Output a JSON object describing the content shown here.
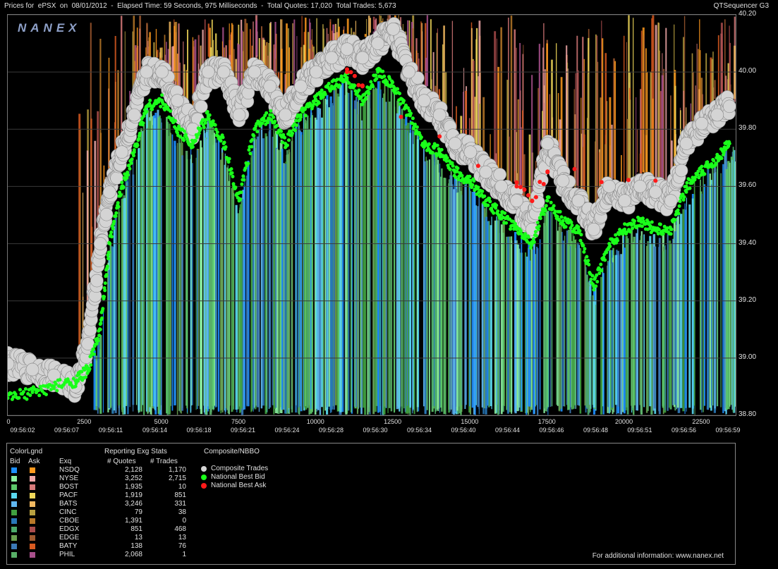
{
  "header": {
    "title": "Prices for  ePSX  on  08/01/2012  -  Elapsed Time: 59 Seconds, 975 Milliseconds  -  Total Quotes: 17,020  Total Trades: 5,673",
    "app": "QTSequencer G3"
  },
  "logo": "NANEX",
  "chart_data": {
    "type": "scatter",
    "ylim": [
      38.8,
      40.2
    ],
    "xlim": [
      0,
      23600
    ],
    "y_ticks": [
      "40.20",
      "40.00",
      "39.80",
      "39.60",
      "39.40",
      "39.20",
      "39.00",
      "38.80"
    ],
    "x_ticks": [
      "0",
      "2500",
      "5000",
      "7500",
      "10000",
      "12500",
      "15000",
      "17500",
      "20000",
      "22500"
    ],
    "time_labels": [
      "09:56:02",
      "09:56:07",
      "09:56:11",
      "09:56:14",
      "09:56:18",
      "09:56:21",
      "09:56:24",
      "09:56:28",
      "09:56:30",
      "09:56:34",
      "09:56:40",
      "09:56:44",
      "09:56:46",
      "09:56:48",
      "09:56:51",
      "09:56:56",
      "09:56:59"
    ],
    "series": [
      {
        "name": "Composite Trades",
        "x": [
          0,
          800,
          1500,
          2200,
          2600,
          3000,
          3300,
          3700,
          4100,
          4500,
          5000,
          5500,
          6000,
          6500,
          7000,
          7500,
          8000,
          8500,
          9000,
          9500,
          10000,
          10500,
          11000,
          11500,
          12000,
          12500,
          13000,
          13500,
          14000,
          14500,
          15000,
          15500,
          16000,
          16500,
          17000,
          17500,
          18000,
          18500,
          19000,
          19500,
          20000,
          20500,
          21000,
          21500,
          22000,
          22500,
          23000,
          23400
        ],
        "y": [
          38.98,
          38.96,
          38.94,
          38.9,
          39.05,
          39.4,
          39.58,
          39.72,
          39.85,
          40.0,
          40.0,
          39.9,
          39.8,
          40.0,
          40.0,
          39.85,
          40.0,
          39.95,
          39.85,
          39.95,
          40.0,
          40.05,
          40.08,
          40.05,
          40.1,
          40.15,
          40.0,
          39.9,
          39.85,
          39.75,
          39.72,
          39.65,
          39.6,
          39.55,
          39.45,
          39.75,
          39.62,
          39.55,
          39.45,
          39.6,
          39.55,
          39.6,
          39.58,
          39.55,
          39.75,
          39.82,
          39.85,
          39.88
        ]
      },
      {
        "name": "National Best Bid",
        "x": [
          0,
          800,
          1500,
          2200,
          2600,
          3000,
          3300,
          3700,
          4100,
          4500,
          5000,
          5500,
          6000,
          6500,
          7000,
          7500,
          8000,
          8500,
          9000,
          9500,
          10000,
          10500,
          11000,
          11500,
          12000,
          12500,
          13000,
          13500,
          14000,
          14500,
          15000,
          15500,
          16000,
          16500,
          17000,
          17500,
          18000,
          18500,
          19000,
          19500,
          20000,
          20500,
          21000,
          21500,
          22000,
          22500,
          23000,
          23400
        ],
        "y": [
          38.86,
          38.88,
          38.9,
          38.92,
          38.96,
          39.1,
          39.4,
          39.6,
          39.72,
          39.88,
          39.9,
          39.8,
          39.75,
          39.85,
          39.75,
          39.55,
          39.8,
          39.85,
          39.75,
          39.85,
          39.9,
          39.95,
          39.98,
          39.9,
          40.0,
          39.95,
          39.85,
          39.75,
          39.72,
          39.65,
          39.62,
          39.55,
          39.5,
          39.45,
          39.4,
          39.55,
          39.48,
          39.45,
          39.25,
          39.4,
          39.45,
          39.48,
          39.45,
          39.45,
          39.6,
          39.65,
          39.7,
          39.75
        ]
      },
      {
        "name": "National Best Ask",
        "x": [
          11000,
          11500,
          16500,
          17000,
          17500,
          21000
        ],
        "y": [
          40.0,
          39.95,
          39.6,
          39.55,
          39.65,
          39.62
        ]
      }
    ]
  },
  "legend": {
    "title": "ColorLgnd",
    "bid_hdr": "Bid",
    "ask_hdr": "Ask",
    "exq_hdr": "Exq",
    "stats_title": "Reporting Exg Stats",
    "quotes_hdr": "# Quotes",
    "trades_hdr": "# Trades",
    "composite_title": "Composite/NBBO",
    "rows": [
      {
        "exq": "NSDQ",
        "quotes": "2,128",
        "trades": "1,170",
        "bid": "#1e90ff",
        "ask": "#ff9a1e"
      },
      {
        "exq": "NYSE",
        "quotes": "3,252",
        "trades": "2,715",
        "bid": "#8cf0a0",
        "ask": "#f0a8a8"
      },
      {
        "exq": "BOST",
        "quotes": "1,935",
        "trades": "10",
        "bid": "#5cc86a",
        "ask": "#d87a7a"
      },
      {
        "exq": "PACF",
        "quotes": "1,919",
        "trades": "851",
        "bid": "#5ad8f0",
        "ask": "#f0d85a"
      },
      {
        "exq": "BATS",
        "quotes": "3,246",
        "trades": "331",
        "bid": "#60b8f0",
        "ask": "#f0b860"
      },
      {
        "exq": "CINC",
        "quotes": "79",
        "trades": "38",
        "bid": "#40a040",
        "ask": "#b8a040"
      },
      {
        "exq": "CBOE",
        "quotes": "1,391",
        "trades": "0",
        "bid": "#2878b8",
        "ask": "#b87828"
      },
      {
        "exq": "EDGX",
        "quotes": "851",
        "trades": "468",
        "bid": "#4caa6a",
        "ask": "#aa4c4c"
      },
      {
        "exq": "EDGE",
        "quotes": "13",
        "trades": "13",
        "bid": "#6aa050",
        "ask": "#a05a30"
      },
      {
        "exq": "BATY",
        "quotes": "138",
        "trades": "76",
        "bid": "#3c7ab8",
        "ask": "#d85a20"
      },
      {
        "exq": "PHIL",
        "quotes": "2,068",
        "trades": "1",
        "bid": "#58b068",
        "ask": "#a8508c"
      }
    ],
    "nbbo": [
      {
        "label": "Composite Trades",
        "color": "#d4d4d4"
      },
      {
        "label": "National Best Bid",
        "color": "#1aff1a"
      },
      {
        "label": "National Best Ask",
        "color": "#ff1a1a"
      }
    ]
  },
  "footer": "For additional information: www.nanex.net"
}
